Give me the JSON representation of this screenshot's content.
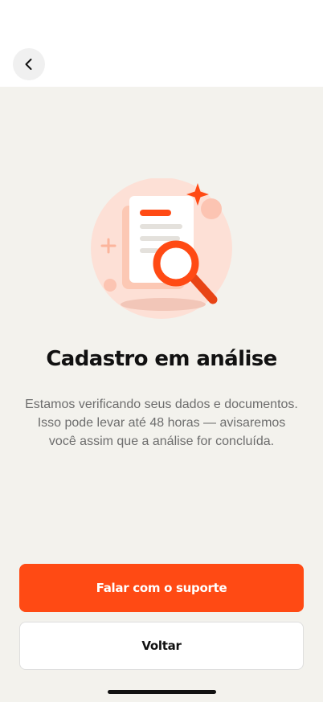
{
  "header": {
    "back_icon": "chevron-left-icon"
  },
  "illustration": {
    "icon": "document-search-illustration",
    "accent_color": "#ff4a14",
    "background_color": "#fde0d6"
  },
  "content": {
    "title": "Cadastro em análise",
    "description": "Estamos verificando seus dados e documentos. Isso pode levar até 48 horas — avisaremos você assim que a análise for concluída."
  },
  "actions": {
    "primary_label": "Falar com o suporte",
    "secondary_label": "Voltar",
    "primary_color": "#ff4a14"
  }
}
